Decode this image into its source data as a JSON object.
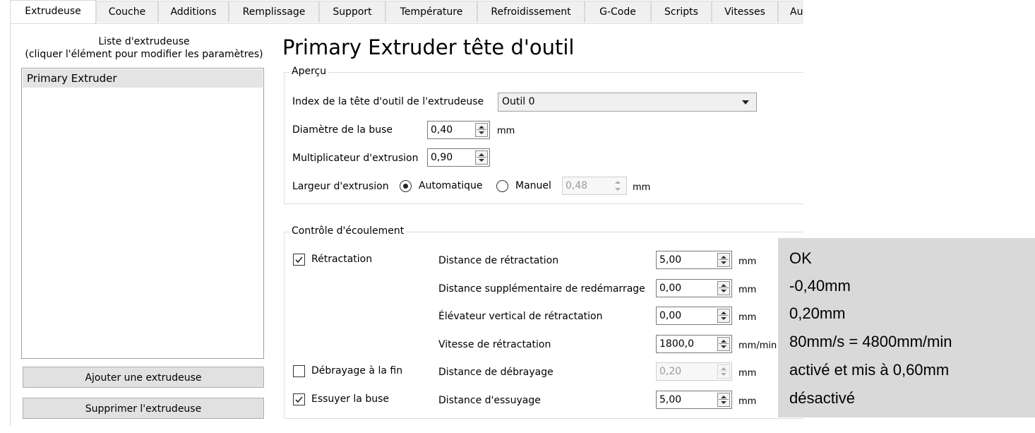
{
  "tabs": [
    {
      "label": "Extrudeuse",
      "active": true
    },
    {
      "label": "Couche"
    },
    {
      "label": "Additions"
    },
    {
      "label": "Remplissage"
    },
    {
      "label": "Support"
    },
    {
      "label": "Température"
    },
    {
      "label": "Refroidissement"
    },
    {
      "label": "G-Code"
    },
    {
      "label": "Scripts"
    },
    {
      "label": "Vitesses"
    },
    {
      "label": "Au"
    }
  ],
  "extruder_list": {
    "caption_line1": "Liste d'extrudeuse",
    "caption_line2": "(cliquer l'élément pour modifier les paramètres)",
    "items": [
      "Primary Extruder"
    ],
    "add_button": "Ajouter une extrudeuse",
    "remove_button": "Supprimer l'extrudeuse"
  },
  "title": "Primary Extruder tête d'outil",
  "overview": {
    "group_label": "Aperçu",
    "tool_index_label": "Index de la tête d'outil de l'extrudeuse",
    "tool_index_value": "Outil 0",
    "nozzle_label": "Diamètre de la buse",
    "nozzle_value": "0,40",
    "nozzle_unit": "mm",
    "multiplier_label": "Multiplicateur d'extrusion",
    "multiplier_value": "0,90",
    "width_label": "Largeur d'extrusion",
    "auto_label": "Automatique",
    "manual_label": "Manuel",
    "manual_value": "0,48",
    "manual_unit": "mm"
  },
  "flow": {
    "group_label": "Contrôle d'écoulement",
    "retraction_label": "Rétractation",
    "retraction_checked": true,
    "retract_distance_label": "Distance de rétractation",
    "retract_distance_value": "5,00",
    "restart_extra_label": "Distance supplémentaire de redémarrage",
    "restart_extra_value": "0,00",
    "vertical_lift_label": "Élévateur vertical de rétractation",
    "vertical_lift_value": "0,00",
    "retract_speed_label": "Vitesse de rétractation",
    "retract_speed_value": "1800,0",
    "coast_label": "Débrayage à la fin",
    "coast_checked": false,
    "coast_distance_label": "Distance de débrayage",
    "coast_distance_value": "0,20",
    "wipe_label": "Essuyer la buse",
    "wipe_checked": true,
    "wipe_distance_label": "Distance d'essuyage",
    "wipe_distance_value": "5,00",
    "unit_mm": "mm",
    "unit_mm_min": "mm/min"
  },
  "annotation": {
    "lines": [
      "OK",
      "-0,40mm",
      "0,20mm",
      "80mm/s = 4800mm/min",
      "activé et mis à 0,60mm",
      "désactivé"
    ]
  },
  "colors": {
    "panel_bg": "#ffffff",
    "tab_bg": "#f0f0f0",
    "note_bg": "#d9d9d9",
    "list_selected": "#e4e4e4"
  }
}
